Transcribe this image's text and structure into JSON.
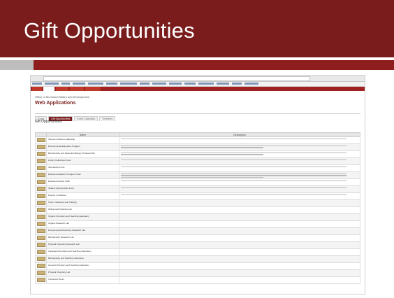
{
  "slide": {
    "title": "Gift Opportunities"
  },
  "app": {
    "org": "Office of Alumnae/i Affairs and Development",
    "title": "Web Applications",
    "section_title": "Gift Opportunities",
    "tabs": [
      {
        "label": "Goals"
      },
      {
        "label": "Gift Opportunities",
        "active": true
      },
      {
        "label": "Event Calendars"
      },
      {
        "label": "Timelines"
      }
    ],
    "nav": [
      {
        "label": "Grant Search"
      },
      {
        "label": "Web Apps",
        "active": true
      },
      {
        "label": "Reports"
      },
      {
        "label": "Help"
      },
      {
        "label": "About"
      }
    ],
    "table": {
      "columns": [
        "Name",
        "Description"
      ],
      "rows": [
        {
          "name": "Science Initiative Leadership",
          "desc_lines": 1
        },
        {
          "name": "Environmental Education Program",
          "desc_lines": 2
        },
        {
          "name": "Biochemistry and Molecular Biology Professorship",
          "desc_lines": 2
        },
        {
          "name": "Library Collections Fund",
          "desc_lines": 1
        },
        {
          "name": "Scholarship Fund",
          "desc_lines": 1
        },
        {
          "name": "Endowed Academic Program Chair",
          "desc_lines": 3
        },
        {
          "name": "Endowed Faculty Chair",
          "desc_lines": 1
        },
        {
          "name": "Student Opportunities Fund",
          "desc_lines": 1
        },
        {
          "name": "Director of Athletics",
          "desc_lines": 1
        },
        {
          "name": "Tools, Collections and Training",
          "desc_lines": 0
        },
        {
          "name": "Writing and Teaching Lab",
          "desc_lines": 0
        },
        {
          "name": "Organic Chemistry and Teaching Laboratory",
          "desc_lines": 0
        },
        {
          "name": "Organic Research Lab",
          "desc_lines": 0
        },
        {
          "name": "Environmental Chemistry Research Lab",
          "desc_lines": 0
        },
        {
          "name": "Biochemistry Research Lab",
          "desc_lines": 0
        },
        {
          "name": "Physical Chemistry Research Lab",
          "desc_lines": 0
        },
        {
          "name": "Integrated Chemistry and Teaching Laboratory",
          "desc_lines": 0
        },
        {
          "name": "Biochemistry and Teaching Laboratory",
          "desc_lines": 0
        },
        {
          "name": "General Chemistry and Teaching Laboratory",
          "desc_lines": 0
        },
        {
          "name": "Physical Chemistry Lab",
          "desc_lines": 0
        },
        {
          "name": "Instrument Room",
          "desc_lines": 0
        }
      ]
    }
  },
  "colors": {
    "brand": "#7a1c1c",
    "accent_red": "#8e1e1e",
    "rule_gray": "#bdbdbd"
  }
}
